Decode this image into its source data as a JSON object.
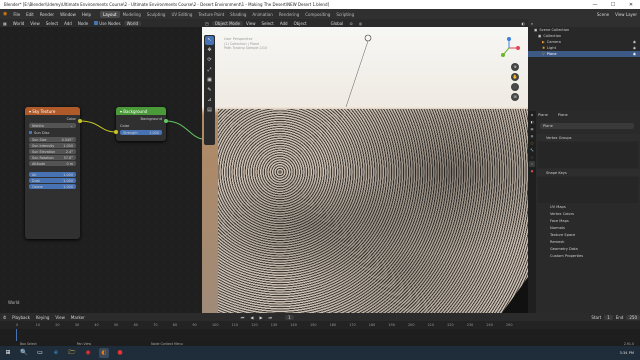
{
  "window": {
    "title": "Blender* [E:\\Blender\\Udemy\\Ultimate Environments Course\\2 - Ultimate Environments Course\\2 - Desert Environment\\1 - Making The Desert\\NEW Desert 1.blend]",
    "controls": [
      "—",
      "☐",
      "✕"
    ]
  },
  "menubar": {
    "menus": [
      "File",
      "Edit",
      "Render",
      "Window",
      "Help"
    ],
    "workspaces": [
      "Layout",
      "Modeling",
      "Sculpting",
      "UV Editing",
      "Texture Paint",
      "Shading",
      "Animation",
      "Rendering",
      "Compositing",
      "Scripting"
    ],
    "active_workspace": "Layout",
    "scene_label": "Scene",
    "viewlayer_label": "View Layer"
  },
  "node_editor": {
    "header_items": [
      "World",
      "View",
      "Select",
      "Add",
      "Node",
      "Use Nodes"
    ],
    "world_name": "World",
    "footer_label": "World",
    "sky_node": {
      "title": "Sky Texture",
      "output": "Color",
      "type": "Nishita",
      "sun_disc": "Sun Disc",
      "fields": [
        {
          "label": "Sun Size",
          "value": "0.545°"
        },
        {
          "label": "Sun Intensity",
          "value": "1.000"
        },
        {
          "label": "Sun Elevation",
          "value": "2.4°"
        },
        {
          "label": "Sun Rotation",
          "value": "57.8°"
        },
        {
          "label": "Altitude",
          "value": "0 m"
        }
      ],
      "vector_fields": [
        {
          "label": "Air",
          "value": "1.000"
        },
        {
          "label": "Dust",
          "value": "1.000"
        },
        {
          "label": "Ozone",
          "value": "1.000"
        }
      ]
    },
    "bg_node": {
      "title": "Background",
      "output": "Background",
      "input_color": "Color",
      "strength_label": "Strength",
      "strength_value": "1.000"
    }
  },
  "viewport": {
    "header_items": [
      "Object Mode",
      "View",
      "Select",
      "Add",
      "Object"
    ],
    "transform": "Global",
    "overlay_lines": [
      "User Perspective",
      "(1) Collection | Plane",
      "Path Tracing Sample 2/10"
    ],
    "tools": [
      "↖",
      "✥",
      "⟳",
      "⤢",
      "▣",
      "✎",
      "⊿",
      "▤"
    ],
    "nav_buttons": [
      "⊕",
      "✋",
      "🎥",
      "⊞"
    ]
  },
  "outliner": {
    "header": "Scene Collection",
    "items": [
      {
        "label": "Collection",
        "selected": false
      },
      {
        "label": "Camera",
        "selected": false
      },
      {
        "label": "Light",
        "selected": false
      },
      {
        "label": "Plane",
        "selected": true
      }
    ]
  },
  "properties": {
    "object_name": "Plane",
    "mesh_name": "Plane",
    "sections": [
      "Vertex Groups",
      "Shape Keys",
      "UV Maps",
      "Vertex Colors",
      "Face Maps",
      "Normals",
      "Texture Space",
      "Remesh",
      "Geometry Data",
      "Custom Properties"
    ]
  },
  "timeline": {
    "header_items": [
      "Playback",
      "Keying",
      "View",
      "Marker"
    ],
    "current_frame": "1",
    "start_label": "Start",
    "start_value": "1",
    "end_label": "End",
    "end_value": "250",
    "ticks": [
      "0",
      "10",
      "20",
      "30",
      "40",
      "50",
      "60",
      "70",
      "80",
      "90",
      "100",
      "110",
      "120",
      "130",
      "140",
      "150",
      "160",
      "170",
      "180",
      "190",
      "200",
      "210",
      "220",
      "230",
      "240",
      "250"
    ]
  },
  "statusbar": {
    "left": "Box Select",
    "mid1": "Pan View",
    "mid2": "Node Context Menu",
    "right": "2.91.0"
  },
  "taskbar": {
    "icons": [
      "⊞",
      "🔍",
      "▭",
      "e",
      "🗁",
      "◉",
      "◐",
      "●"
    ],
    "clock": "3:34 PM"
  },
  "colors": {
    "accent": "#4772b3",
    "sky_node_header": "#b05a2a",
    "bg_node_header": "#4a9a3a",
    "socket_yellow": "#c7c729",
    "socket_green": "#63c763"
  }
}
